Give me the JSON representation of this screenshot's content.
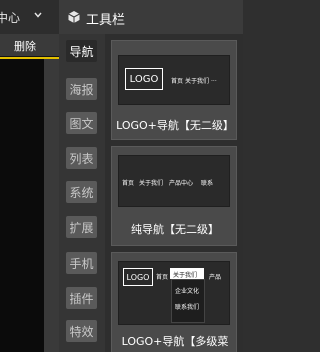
{
  "left": {
    "topbar_text": "中心",
    "delete_label": "删除",
    "accent_color": "#e3c000"
  },
  "toolbar": {
    "title": "工具栏",
    "categories": [
      "导航",
      "海报",
      "图文",
      "列表",
      "系统",
      "扩展",
      "手机",
      "插件",
      "特效"
    ],
    "active_category": "导航"
  },
  "cards": [
    {
      "label": "LOGO+导航【无二级】",
      "logo": "LOGO",
      "nav": [
        "首页",
        "关于我们",
        "..."
      ]
    },
    {
      "label": "纯导航【无二级】",
      "nav": [
        "首页",
        "关于我们",
        "产品中心",
        "联系"
      ]
    },
    {
      "label": "LOGO+导航【多级菜",
      "logo": "LOGO",
      "nav": [
        "首页",
        "关于我们",
        "产品"
      ],
      "dropdown": [
        "企业文化",
        "联系我们"
      ]
    }
  ]
}
